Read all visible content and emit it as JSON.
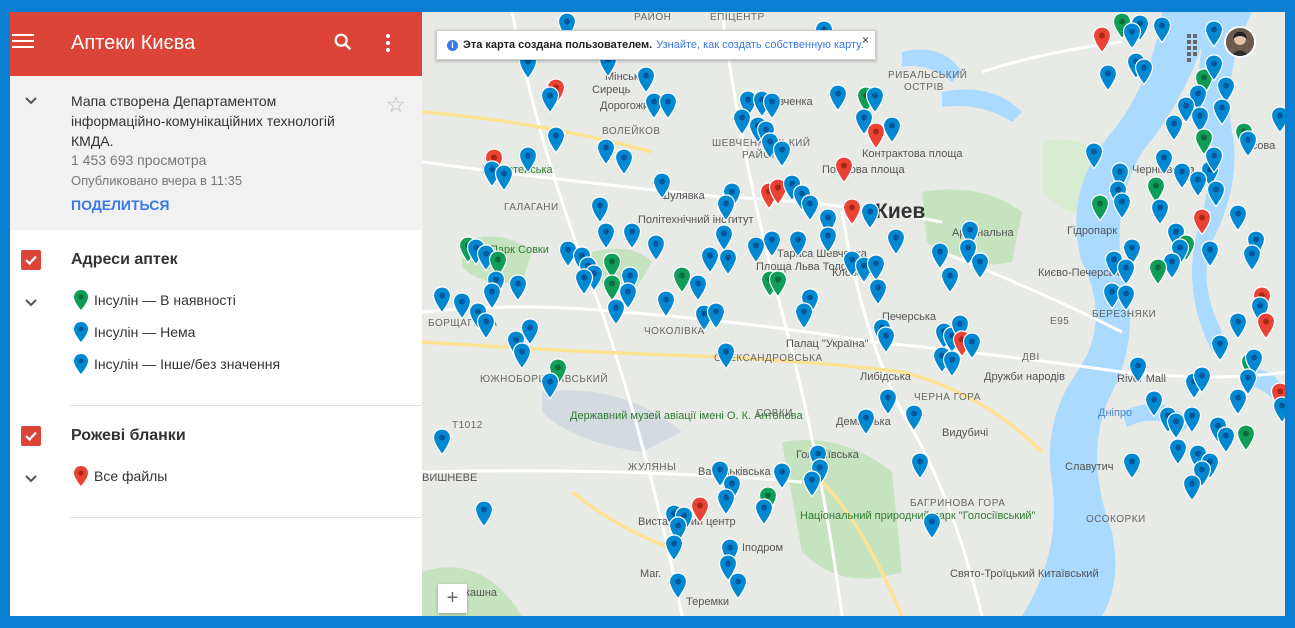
{
  "app": {
    "title": "Аптеки Києва",
    "search_icon": "search-icon",
    "more_icon": "more-vert-icon"
  },
  "info": {
    "description": "Мапа створена Департаментом інформаційно-комунікаційних технологій КМДА.",
    "views": "1 453 693 просмотра",
    "published": "Опубликовано вчера в 11:35",
    "share_label": "ПОДЕЛИТЬСЯ"
  },
  "layers": [
    {
      "title": "Адреси аптек",
      "items": [
        {
          "label": "Інсулін — В наявності",
          "color": "#0f9d58"
        },
        {
          "label": "Інсулін — Нема",
          "color": "#0288d1"
        },
        {
          "label": "Інсулін — Інше/без значення",
          "color": "#0288d1"
        }
      ]
    },
    {
      "title": "Рожеві бланки",
      "items": [
        {
          "label": "Все файлы",
          "color": "#ea4335"
        }
      ]
    }
  ],
  "map": {
    "banner_bold": "Эта карта создана пользователем.",
    "banner_link": "Узнайте, как создать собственную карту.",
    "close": "×",
    "zoom_in": "+",
    "labels": {
      "kyiv": "Киев",
      "l1": "РАЙОН",
      "l2": "ЕПІЦЕНТР",
      "l3": "РИБАЛЬСЬКИЙ",
      "l4": "ОСТРІВ",
      "l5": "Сирець",
      "l6": "Дорогожичі",
      "l7": "Шевченка",
      "l8": "ВОЛЕЙКОВ",
      "l9": "ШЕВЧЕНКІВСЬКИЙ",
      "l10": "РАЙОН",
      "l11": "Контрактова площа",
      "l12": "Поштова площа",
      "l13": "Берестейська",
      "l14": "ГАЛАГАНИ",
      "l15": "Політехнічний інститут",
      "l16": "Парк Совки",
      "l17": "Арсенальна",
      "l18": "Гідропарк",
      "l19": "Києво-Печерська",
      "l20": "Палац \"Україна\"",
      "l21": "Либідська",
      "l22": "Дружби народів",
      "l23": "ЧОКОЛІВКА",
      "l24": "ОЛЕКСАНДРОВСЬКА",
      "l25": "Державний музей авіації імені О. К. Антонова",
      "l26": "СОВКИ",
      "l27": "Деміївська",
      "l28": "Голосіївська",
      "l29": "Видубичі",
      "l30": "ЧЕРНА ГОРА",
      "l31": "ЖУЛЯНЫ",
      "l32": "Васильківська",
      "l33": "Національний природний парк \"Голосіївський\"",
      "l34": "БАГРИНОВА ГОРА",
      "l35": "Славутич",
      "l36": "ОСОКОРКИ",
      "l37": "River Mall",
      "l38": "Виставковий центр",
      "l39": "Іподром",
      "l40": "Свято-Троїцький Китаївський",
      "l41": "Теремки",
      "l42": "БЕРЕЗНЯКИ",
      "l43": "ДВІ",
      "l44": "ЮЖНОБОРЩАГІВСЬКИЙ",
      "l45": "БОРЩАГІВКА",
      "l46": "Печерська",
      "l47": "Лісова",
      "l48": "Чернігівська",
      "l49": "Дніпро",
      "l50": "Мінська",
      "l51": "Шулявка",
      "l52": "Площа Льва Толстого",
      "l53": "Кловська",
      "l54": "Тараса Шевченка",
      "l55": "ВИШНЕВЕ",
      "l56": "Маг.",
      "l57": "Лукашна",
      "l58": "E95",
      "l59": "T1012"
    }
  }
}
